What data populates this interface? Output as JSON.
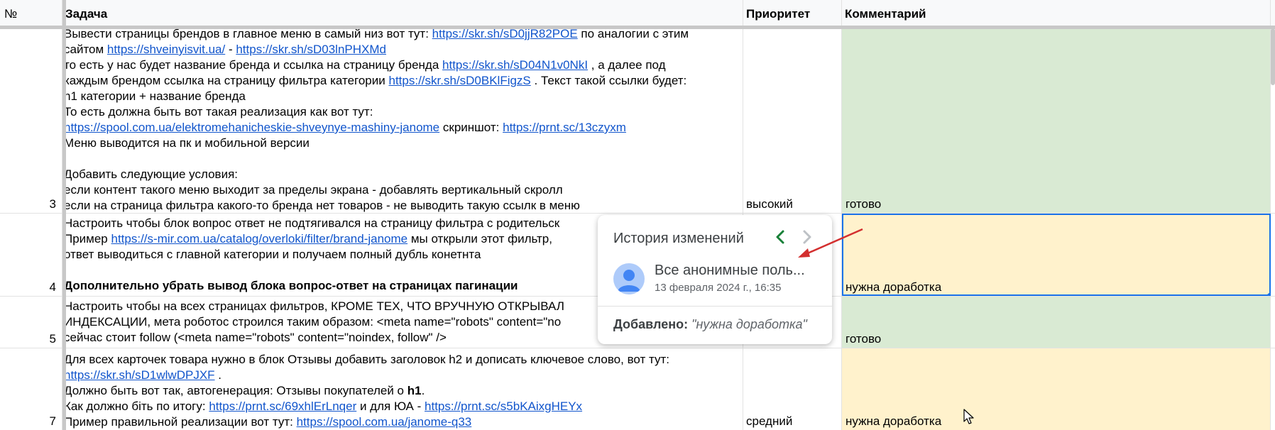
{
  "header": {
    "num": "№",
    "task": "Задача",
    "priority": "Приоритет",
    "comment": "Комментарий"
  },
  "rows": [
    {
      "num": "3",
      "priority": "высокий",
      "comment": "готово",
      "lines": {
        "l1a": "Вывести страницы брендов в главное меню в самый низ вот тут: ",
        "l1link": "https://skr.sh/sD0jjR82POE",
        "l1b": "  по аналогии с этим",
        "l2a": "сайтом ",
        "l2link1": "https://shveinyisvit.ua/",
        "l2b": " - ",
        "l2link2": "https://skr.sh/sD03lnPHXMd",
        "l3a": "то есть у нас будет название бренда и ссылка на страницу бренда ",
        "l3link": "https://skr.sh/sD04N1v0NkI",
        "l3b": " , а далее под",
        "l4a": "каждым брендом ссылка на страницу фильтра категории ",
        "l4link": "https://skr.sh/sD0BKlFigzS",
        "l4b": " . Текст такой ссылки будет:",
        "l5": "h1 категории + название бренда",
        "l6": "То есть должна быть вот такая реализация как вот тут:",
        "l7link1": "https://spool.com.ua/elektromehanicheskie-shveynye-mashiny-janome",
        "l7b": " скриншот: ",
        "l7link2": "https://prnt.sc/13czyxm",
        "l8": "Меню выводится на пк и мобильной версии",
        "l10": "Добавить следующие условия:",
        "l11": "если контент такого меню выходит за пределы экрана - добавлять вертикальный скролл",
        "l12": "если на страница фильтра какого-то бренда нет товаров - не выводить такую ссылк в меню"
      }
    },
    {
      "num": "4",
      "priority": "",
      "comment": "нужна доработка",
      "lines": {
        "l1": "Настроить чтобы блок вопрос ответ не подтягивался на страницу фильтра с родительск",
        "l2a": "Пример ",
        "l2link": "https://s-mir.com.ua/catalog/overloki/filter/brand-janome",
        "l2b": "   мы открыли этот фильтр,",
        "l3": "ответ выводиться с главной категории и получаем полный дубль конетнта",
        "l5": "Дополнительно убрать вывод блока вопрос-ответ на страницах пагинации"
      }
    },
    {
      "num": "5",
      "priority": "",
      "comment": "готово",
      "lines": {
        "l1": "Настроить чтобы на всех страницах фильтров, КРОМЕ ТЕХ, ЧТО ВРУЧНУЮ ОТКРЫВАЛ",
        "l2": "ИНДЕКСАЦИИ, мета роботос строился таким образом: <meta name=\"robots\" content=\"no",
        "l3": "сейчас стоит follow (<meta name=\"robots\" content=\"noindex, follow\" />"
      }
    },
    {
      "num": "7",
      "priority": "средний",
      "comment": "нужна доработка",
      "lines": {
        "l1": "Для всех карточек товара нужно в блок Отзывы добавить заголовок h2 и дописать ключевое слово, вот тут:",
        "l2link": "https://skr.sh/sD1wlwDPJXF",
        "l2b": " .",
        "l3a": "Должно быть вот так, автогенерация: Отзывы покупателей о ",
        "l3bold": "h1",
        "l3b": ".",
        "l4a": "Как должно біть по итогу: ",
        "l4link1": "https://prnt.sc/69xhlErLnqer",
        "l4b": " и для ЮА - ",
        "l4link2": "https://prnt.sc/s5bKAixgHEYx",
        "l5a": "Пример правильной реализации вот тут: ",
        "l5link": "https://spool.com.ua/janome-q33"
      }
    }
  ],
  "popup": {
    "title": "История изменений",
    "user": "Все анонимные поль...",
    "date": "13 февраля 2024 г., 16:35",
    "added_label": "Добавлено:",
    "added_value": "\"нужна доработка\""
  },
  "colors": {
    "done": "#d9ead3",
    "needs_work": "#fff2cc",
    "link": "#1155cc",
    "selection": "#1a73e8",
    "arrow": "#d32f2f"
  }
}
